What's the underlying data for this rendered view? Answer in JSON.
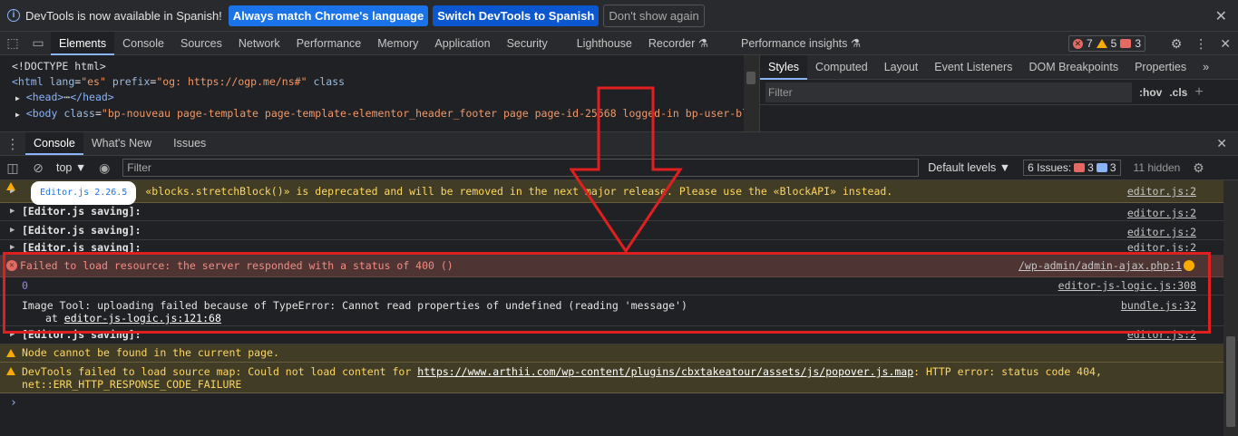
{
  "infobar": {
    "message": "DevTools is now available in Spanish!",
    "btn_match": "Always match Chrome's language",
    "btn_switch": "Switch DevTools to Spanish",
    "btn_dismiss": "Don't show again",
    "close": "✕"
  },
  "main_tabs": [
    "Elements",
    "Console",
    "Sources",
    "Network",
    "Performance",
    "Memory",
    "Application",
    "Security",
    "Lighthouse",
    "Recorder ⚗",
    "Performance insights ⚗"
  ],
  "counters": {
    "errors": "7",
    "warnings": "5",
    "issues": "3"
  },
  "elements": {
    "doctype": "<!DOCTYPE html>",
    "html_open": "<html",
    "html_attr1": "lang",
    "html_val1": "\"es\"",
    "html_attr2": "prefix",
    "html_val2": "\"og: https://ogp.me/ns#\"",
    "html_attr3": "class",
    "head_open": "<head>",
    "head_dots": "⋯",
    "head_close": "</head>",
    "body_open": "<body",
    "body_attr": "class",
    "body_val": "\"bp-nouveau page-template page-template-elementor_header_footer page page-id-25568 logged-in bp-user-blog eh"
  },
  "styles_panel": {
    "tabs": [
      "Styles",
      "Computed",
      "Layout",
      "Event Listeners",
      "DOM Breakpoints",
      "Properties",
      "»"
    ],
    "filter_placeholder": "Filter",
    "hov": ":hov",
    "cls": ".cls",
    "plus": "+"
  },
  "drawer": {
    "tabs": [
      "Console",
      "What's New",
      "Issues"
    ]
  },
  "console_toolbar": {
    "context": "top ▼",
    "filter_placeholder": "Filter",
    "levels": "Default levels ▼",
    "issues_label": "6 Issues:",
    "issues_err": "3",
    "issues_info": "3",
    "hidden": "11 hidden"
  },
  "log": [
    {
      "type": "warn",
      "badge": "Editor.js 2.26.5",
      "text": "«blocks.stretchBlock()» is deprecated and will be removed in the next major release. Please use the «BlockAPI» instead.",
      "source": "editor.js:2"
    },
    {
      "type": "log",
      "text": "[Editor.js saving]:",
      "source": "editor.js:2"
    },
    {
      "type": "log",
      "text": "[Editor.js saving]:",
      "source": "editor.js:2"
    },
    {
      "type": "log",
      "text": "[Editor.js saving]:",
      "source": "editor.js:2"
    },
    {
      "type": "err",
      "text": "Failed to load resource: the server responded with a status of 400 ()",
      "source": "/wp-admin/admin-ajax.php:1"
    },
    {
      "type": "num",
      "text": "0",
      "source": "editor-js-logic.js:308"
    },
    {
      "type": "plain",
      "text": "Image Tool: uploading failed because of TypeError: Cannot read properties of undefined (reading 'message')",
      "text2_prefix": "at ",
      "text2_link": "editor-js-logic.js:121:68",
      "source": "bundle.js:32"
    },
    {
      "type": "log",
      "text": "[Editor.js saving]:",
      "source": "editor.js:2"
    },
    {
      "type": "warn",
      "text": "Node cannot be found in the current page."
    },
    {
      "type": "warn",
      "text_prefix": "DevTools failed to load source map: Could not load content for ",
      "link": "https://www.arthii.com/wp-content/plugins/cbxtakeatour/assets/js/popover.js.map",
      "text_suffix": ": HTTP error: status code 404,",
      "text2": "net::ERR_HTTP_RESPONSE_CODE_FAILURE"
    }
  ],
  "prompt": "›",
  "colors": {
    "accent": "#8ab4f8",
    "warning_bg": "#413c26",
    "error_bg": "#4e3534",
    "highlight": "#e02020"
  }
}
